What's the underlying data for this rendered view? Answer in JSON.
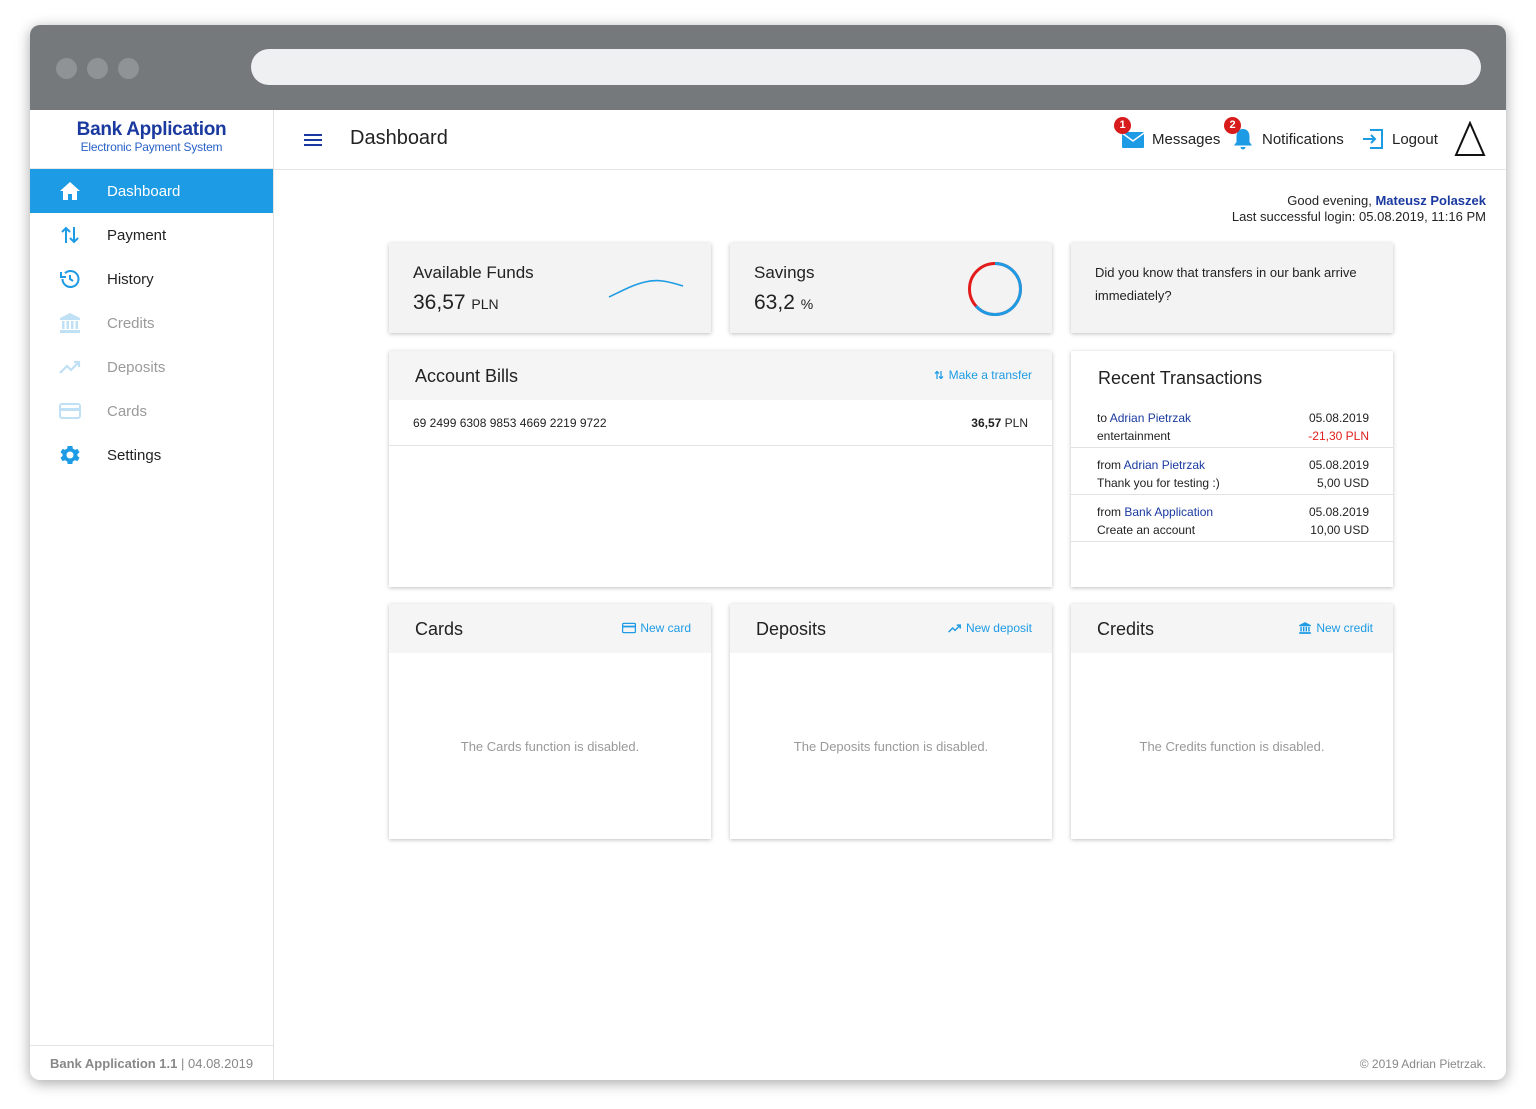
{
  "app": {
    "brand_title": "Bank Application",
    "brand_subtitle": "Electronic Payment System",
    "page_title": "Dashboard"
  },
  "sidebar": {
    "items": [
      {
        "label": "Dashboard",
        "icon": "home-icon",
        "state": "active"
      },
      {
        "label": "Payment",
        "icon": "transfer-arrows-icon",
        "state": "normal"
      },
      {
        "label": "History",
        "icon": "history-icon",
        "state": "normal"
      },
      {
        "label": "Credits",
        "icon": "bank-icon",
        "state": "disabled"
      },
      {
        "label": "Deposits",
        "icon": "trending-up-icon",
        "state": "disabled"
      },
      {
        "label": "Cards",
        "icon": "credit-card-icon",
        "state": "disabled"
      },
      {
        "label": "Settings",
        "icon": "gear-icon",
        "state": "normal"
      }
    ],
    "footer_version": "Bank Application 1.1",
    "footer_sep": " | ",
    "footer_date": "04.08.2019"
  },
  "topbar": {
    "messages_label": "Messages",
    "messages_count": "1",
    "notifications_label": "Notifications",
    "notifications_count": "2",
    "logout_label": "Logout"
  },
  "greeting": {
    "prefix": "Good evening, ",
    "user_name": "Mateusz Polaszek",
    "last_login": "Last successful login: 05.08.2019, 11:16 PM"
  },
  "stats": {
    "funds_label": "Available Funds",
    "funds_value": "36,57",
    "funds_unit": "PLN",
    "savings_label": "Savings",
    "savings_value": "63,2",
    "savings_unit": "%",
    "savings_fraction": 0.632,
    "tip": "Did you know that transfers in our bank arrive immediately?"
  },
  "account_bills": {
    "title": "Account Bills",
    "action": "Make a transfer",
    "rows": [
      {
        "number": "69 2499 6308 9853 4669 2219 9722",
        "amount": "36,57",
        "currency": "PLN"
      }
    ]
  },
  "recent_transactions": {
    "title": "Recent Transactions",
    "items": [
      {
        "direction": "to",
        "party": "Adrian Pietrzak",
        "desc": "entertainment",
        "date": "05.08.2019",
        "amount": "-21,30 PLN",
        "negative": true
      },
      {
        "direction": "from",
        "party": "Adrian Pietrzak",
        "desc": "Thank you for testing :)",
        "date": "05.08.2019",
        "amount": "5,00 USD",
        "negative": false
      },
      {
        "direction": "from",
        "party": "Bank Application",
        "desc": "Create an account",
        "date": "05.08.2019",
        "amount": "10,00 USD",
        "negative": false
      }
    ]
  },
  "cards_panel": {
    "title": "Cards",
    "action": "New card",
    "message": "The Cards function is disabled."
  },
  "deposits_panel": {
    "title": "Deposits",
    "action": "New deposit",
    "message": "The Deposits function is disabled."
  },
  "credits_panel": {
    "title": "Credits",
    "action": "New credit",
    "message": "The Credits function is disabled."
  },
  "footer": {
    "copyright": "© 2019 Adrian Pietrzak."
  },
  "colors": {
    "accent": "#1d9be4",
    "brand": "#1a3aa0",
    "danger": "#e02020",
    "chrome": "#75797c"
  }
}
